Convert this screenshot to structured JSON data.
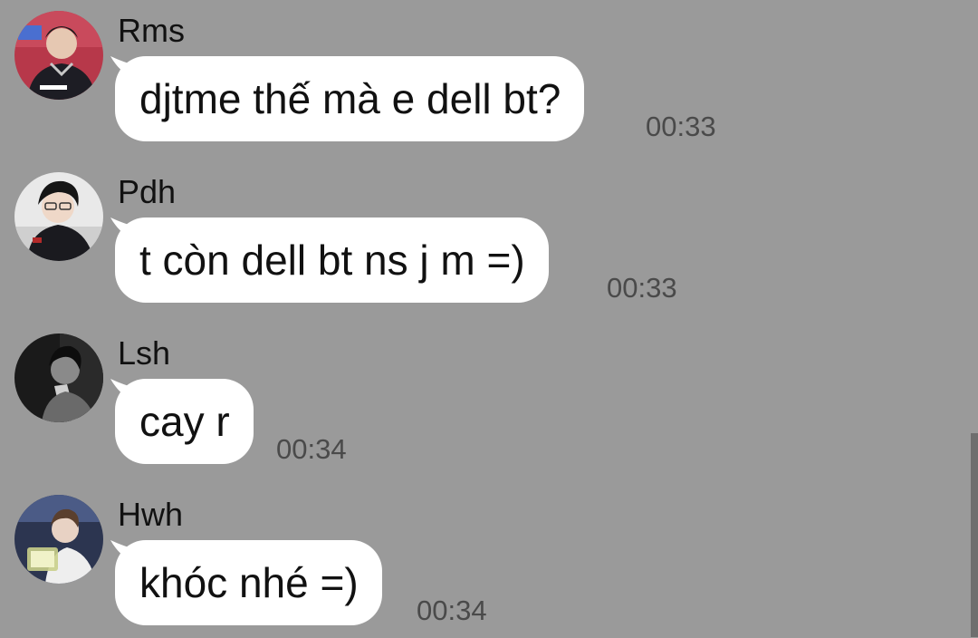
{
  "messages": [
    {
      "sender": "Rms",
      "text": "djtme thế mà e dell bt?",
      "time": "00:33",
      "avatar_icon": "user-photo-icon"
    },
    {
      "sender": "Pdh",
      "text": "t còn dell bt ns j m =)",
      "time": "00:33",
      "avatar_icon": "user-photo-icon"
    },
    {
      "sender": "Lsh",
      "text": "cay r",
      "time": "00:34",
      "avatar_icon": "user-photo-icon"
    },
    {
      "sender": "Hwh",
      "text": "khóc nhé =)",
      "time": "00:34",
      "avatar_icon": "user-photo-icon"
    }
  ],
  "colors": {
    "background": "#9a9a9a",
    "bubble": "#ffffff",
    "timestamp": "#4a4a4a",
    "scrollbar": "#6e6e6e"
  }
}
